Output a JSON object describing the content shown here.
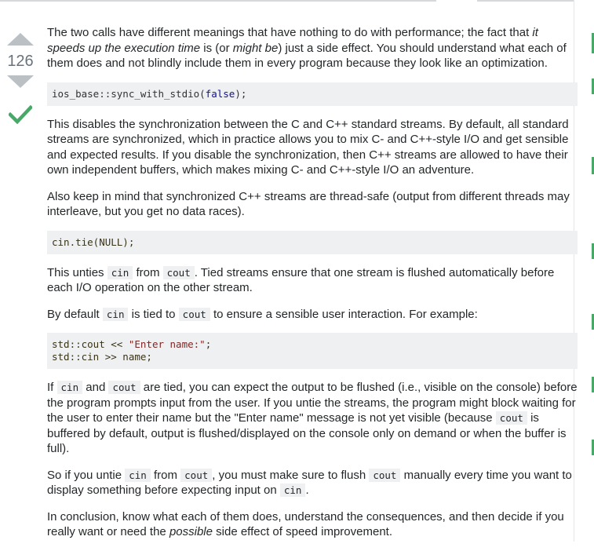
{
  "colors": {
    "accent_green": "#48a868",
    "text": "#242729",
    "code_bg": "#eff0f1",
    "vote_arrow": "#bbc0c4"
  },
  "vote": {
    "score": "126",
    "upvote_icon": "triangle-up-icon",
    "downvote_icon": "triangle-down-icon",
    "accepted_icon": "checkmark-icon"
  },
  "answer": {
    "p1": {
      "a": "The two calls have different meanings that have nothing to do with performance; the fact that ",
      "b": "it speeds up the execution time",
      "c": " is (or ",
      "d": "might be",
      "e": ") just a side effect. You should understand what each of them does and not blindly include them in every program because they look like an optimization."
    },
    "code1": {
      "a": "ios_base::sync_with_stdio(",
      "b": "false",
      "c": ");"
    },
    "p2": "This disables the synchronization between the C and C++ standard streams. By default, all standard streams are synchronized, which in practice allows you to mix C- and C++-style I/O and get sensible and expected results. If you disable the synchronization, then C++ streams are allowed to have their own independent buffers, which makes mixing C- and C++-style I/O an adventure.",
    "p3": "Also keep in mind that synchronized C++ streams are thread-safe (output from different threads may interleave, but you get no data races).",
    "code2": "cin.tie(NULL);",
    "p4": {
      "a": "This unties ",
      "b": "cin",
      "c": " from ",
      "d": "cout",
      "e": ". Tied streams ensure that one stream is flushed automatically before each I/O operation on the other stream."
    },
    "p5": {
      "a": "By default ",
      "b": "cin",
      "c": " is tied to ",
      "d": "cout",
      "e": " to ensure a sensible user interaction. For example:"
    },
    "code3": {
      "line1_a": "std::cout << ",
      "line1_b": "\"Enter name:\"",
      "line1_c": ";",
      "line2": "std::cin >> name;"
    },
    "p6": {
      "a": "If ",
      "b": "cin",
      "c": " and ",
      "d": "cout",
      "e": " are tied, you can expect the output to be flushed (i.e., visible on the console) before the program prompts input from the user. If you untie the streams, the program might block waiting for the user to enter their name but the \"Enter name\" message is not yet visible (because ",
      "f": "cout",
      "g": " is buffered by default, output is flushed/displayed on the console only on demand or when the buffer is full)."
    },
    "p7": {
      "a": "So if you untie ",
      "b": "cin",
      "c": " from ",
      "d": "cout",
      "e": ", you must make sure to flush ",
      "f": "cout",
      "g": " manually every time you want to display something before expecting input on ",
      "h": "cin",
      "i": "."
    },
    "p8": {
      "a": "In conclusion, know what each of them does, understand the consequences, and then decide if you really want or need the ",
      "b": "possible",
      "c": " side effect of speed improvement."
    }
  }
}
